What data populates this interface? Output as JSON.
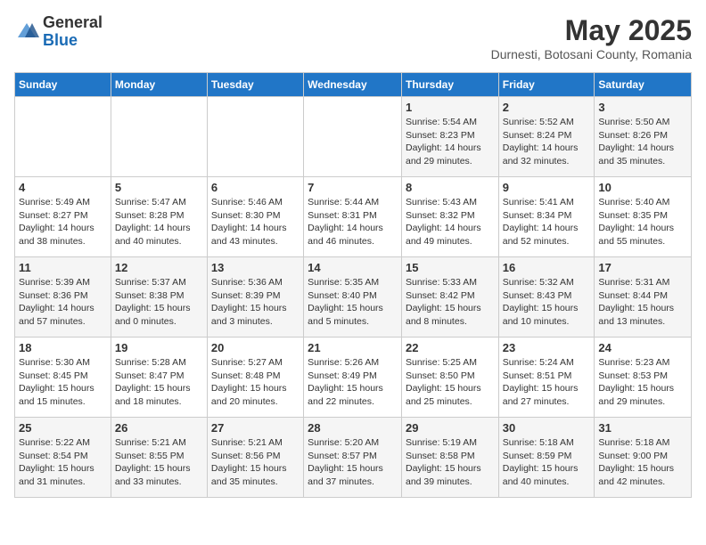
{
  "header": {
    "logo_general": "General",
    "logo_blue": "Blue",
    "month_year": "May 2025",
    "location": "Durnesti, Botosani County, Romania"
  },
  "weekdays": [
    "Sunday",
    "Monday",
    "Tuesday",
    "Wednesday",
    "Thursday",
    "Friday",
    "Saturday"
  ],
  "weeks": [
    [
      {
        "day": "",
        "info": ""
      },
      {
        "day": "",
        "info": ""
      },
      {
        "day": "",
        "info": ""
      },
      {
        "day": "",
        "info": ""
      },
      {
        "day": "1",
        "info": "Sunrise: 5:54 AM\nSunset: 8:23 PM\nDaylight: 14 hours\nand 29 minutes."
      },
      {
        "day": "2",
        "info": "Sunrise: 5:52 AM\nSunset: 8:24 PM\nDaylight: 14 hours\nand 32 minutes."
      },
      {
        "day": "3",
        "info": "Sunrise: 5:50 AM\nSunset: 8:26 PM\nDaylight: 14 hours\nand 35 minutes."
      }
    ],
    [
      {
        "day": "4",
        "info": "Sunrise: 5:49 AM\nSunset: 8:27 PM\nDaylight: 14 hours\nand 38 minutes."
      },
      {
        "day": "5",
        "info": "Sunrise: 5:47 AM\nSunset: 8:28 PM\nDaylight: 14 hours\nand 40 minutes."
      },
      {
        "day": "6",
        "info": "Sunrise: 5:46 AM\nSunset: 8:30 PM\nDaylight: 14 hours\nand 43 minutes."
      },
      {
        "day": "7",
        "info": "Sunrise: 5:44 AM\nSunset: 8:31 PM\nDaylight: 14 hours\nand 46 minutes."
      },
      {
        "day": "8",
        "info": "Sunrise: 5:43 AM\nSunset: 8:32 PM\nDaylight: 14 hours\nand 49 minutes."
      },
      {
        "day": "9",
        "info": "Sunrise: 5:41 AM\nSunset: 8:34 PM\nDaylight: 14 hours\nand 52 minutes."
      },
      {
        "day": "10",
        "info": "Sunrise: 5:40 AM\nSunset: 8:35 PM\nDaylight: 14 hours\nand 55 minutes."
      }
    ],
    [
      {
        "day": "11",
        "info": "Sunrise: 5:39 AM\nSunset: 8:36 PM\nDaylight: 14 hours\nand 57 minutes."
      },
      {
        "day": "12",
        "info": "Sunrise: 5:37 AM\nSunset: 8:38 PM\nDaylight: 15 hours\nand 0 minutes."
      },
      {
        "day": "13",
        "info": "Sunrise: 5:36 AM\nSunset: 8:39 PM\nDaylight: 15 hours\nand 3 minutes."
      },
      {
        "day": "14",
        "info": "Sunrise: 5:35 AM\nSunset: 8:40 PM\nDaylight: 15 hours\nand 5 minutes."
      },
      {
        "day": "15",
        "info": "Sunrise: 5:33 AM\nSunset: 8:42 PM\nDaylight: 15 hours\nand 8 minutes."
      },
      {
        "day": "16",
        "info": "Sunrise: 5:32 AM\nSunset: 8:43 PM\nDaylight: 15 hours\nand 10 minutes."
      },
      {
        "day": "17",
        "info": "Sunrise: 5:31 AM\nSunset: 8:44 PM\nDaylight: 15 hours\nand 13 minutes."
      }
    ],
    [
      {
        "day": "18",
        "info": "Sunrise: 5:30 AM\nSunset: 8:45 PM\nDaylight: 15 hours\nand 15 minutes."
      },
      {
        "day": "19",
        "info": "Sunrise: 5:28 AM\nSunset: 8:47 PM\nDaylight: 15 hours\nand 18 minutes."
      },
      {
        "day": "20",
        "info": "Sunrise: 5:27 AM\nSunset: 8:48 PM\nDaylight: 15 hours\nand 20 minutes."
      },
      {
        "day": "21",
        "info": "Sunrise: 5:26 AM\nSunset: 8:49 PM\nDaylight: 15 hours\nand 22 minutes."
      },
      {
        "day": "22",
        "info": "Sunrise: 5:25 AM\nSunset: 8:50 PM\nDaylight: 15 hours\nand 25 minutes."
      },
      {
        "day": "23",
        "info": "Sunrise: 5:24 AM\nSunset: 8:51 PM\nDaylight: 15 hours\nand 27 minutes."
      },
      {
        "day": "24",
        "info": "Sunrise: 5:23 AM\nSunset: 8:53 PM\nDaylight: 15 hours\nand 29 minutes."
      }
    ],
    [
      {
        "day": "25",
        "info": "Sunrise: 5:22 AM\nSunset: 8:54 PM\nDaylight: 15 hours\nand 31 minutes."
      },
      {
        "day": "26",
        "info": "Sunrise: 5:21 AM\nSunset: 8:55 PM\nDaylight: 15 hours\nand 33 minutes."
      },
      {
        "day": "27",
        "info": "Sunrise: 5:21 AM\nSunset: 8:56 PM\nDaylight: 15 hours\nand 35 minutes."
      },
      {
        "day": "28",
        "info": "Sunrise: 5:20 AM\nSunset: 8:57 PM\nDaylight: 15 hours\nand 37 minutes."
      },
      {
        "day": "29",
        "info": "Sunrise: 5:19 AM\nSunset: 8:58 PM\nDaylight: 15 hours\nand 39 minutes."
      },
      {
        "day": "30",
        "info": "Sunrise: 5:18 AM\nSunset: 8:59 PM\nDaylight: 15 hours\nand 40 minutes."
      },
      {
        "day": "31",
        "info": "Sunrise: 5:18 AM\nSunset: 9:00 PM\nDaylight: 15 hours\nand 42 minutes."
      }
    ]
  ]
}
